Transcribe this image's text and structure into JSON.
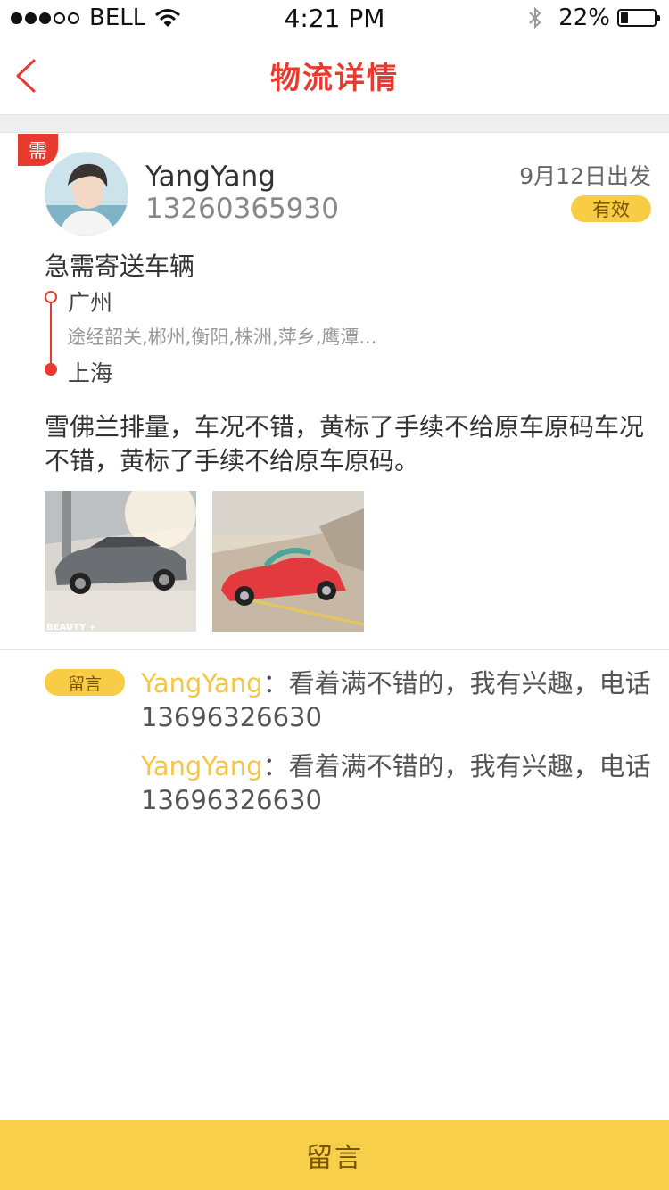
{
  "status_bar": {
    "carrier": "BELL",
    "time": "4:21 PM",
    "battery_percent": "22%",
    "battery_level": 0.22,
    "signal_bars_filled": 3,
    "signal_bars_total": 5
  },
  "nav": {
    "title": "物流详情",
    "back_icon": "chevron-left-icon"
  },
  "post": {
    "type_badge": "需",
    "user_name": "YangYang",
    "user_phone": "13260365930",
    "depart": "9月12日出发",
    "status": "有效",
    "title": "急需寄送车辆",
    "origin": "广州",
    "via": "途经韶关,郴州,衡阳,株洲,萍乡,鹰潭...",
    "destination": "上海",
    "description": "雪佛兰排量，车况不错，黄标了手续不给原车原码车况不错，黄标了手续不给原车原码。",
    "photo1_caption": "BEAUTY +"
  },
  "comments": {
    "tag": "留言",
    "items": [
      {
        "who": "YangYang",
        "text": "：看着满不错的，我有兴趣，电话13696326630"
      },
      {
        "who": "YangYang",
        "text": "：看着满不错的，我有兴趣，电话13696326630"
      }
    ]
  },
  "bottom": {
    "button_label": "留言"
  },
  "colors": {
    "accent_red": "#e63b2e",
    "accent_yellow": "#f8cf4b",
    "commenter_name": "#f5c547"
  }
}
